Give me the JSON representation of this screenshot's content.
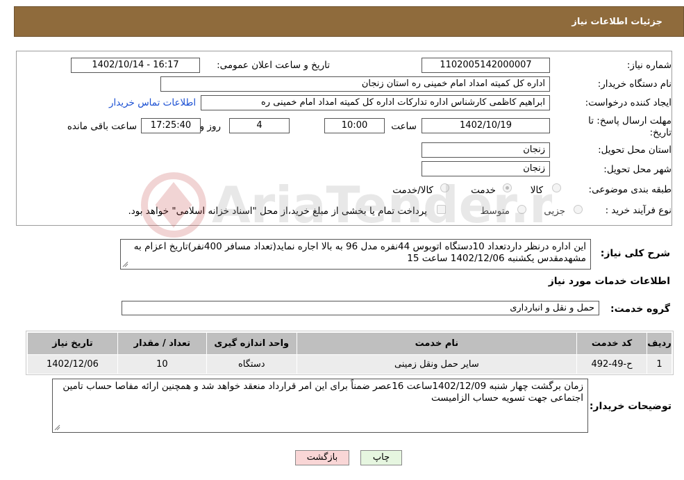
{
  "header": {
    "title": "جزئیات اطلاعات نیاز"
  },
  "form": {
    "need_number": {
      "label": "شماره نیاز:",
      "value": "1102005142000007"
    },
    "announce_datetime": {
      "label": "تاریخ و ساعت اعلان عمومی:",
      "value": "1402/10/14 - 16:17"
    },
    "buyer_org": {
      "label": "نام دستگاه خریدار:",
      "value": "اداره کل کمیته امداد امام خمینی  ره  استان زنجان"
    },
    "requester": {
      "label": "ایجاد کننده درخواست:",
      "value": "ابراهیم  کاظمی  کارشناس اداره تدارکات  اداره کل کمیته امداد امام خمینی  ره"
    },
    "contact_link": "اطلاعات تماس خریدار",
    "deadline": {
      "label_line1": "مهلت ارسال پاسخ: تا",
      "label_line2": "تاریخ:",
      "date": "1402/10/19",
      "time_label": "ساعت",
      "time": "10:00",
      "days": "4",
      "days_label": "روز و",
      "remaining": "17:25:40",
      "remaining_label": "ساعت باقی مانده"
    },
    "delivery_province": {
      "label": "استان محل تحویل:",
      "value": "زنجان"
    },
    "delivery_city": {
      "label": "شهر محل تحویل:",
      "value": "زنجان"
    },
    "category": {
      "label": "طبقه بندی موضوعی:",
      "options": [
        {
          "label": "کالا",
          "checked": false
        },
        {
          "label": "خدمت",
          "checked": true
        },
        {
          "label": "کالا/خدمت",
          "checked": false
        }
      ]
    },
    "purchase_process": {
      "label": "نوع فرآیند خرید :",
      "options": [
        {
          "label": "جزیی",
          "checked": false
        },
        {
          "label": "متوسط",
          "checked": false
        }
      ],
      "note_checkbox_label": "پرداخت تمام یا بخشی از مبلغ خرید،از محل \"اسناد خزانه اسلامی\" خواهد بود."
    }
  },
  "description": {
    "label": "شرح کلی نیاز:",
    "text": "این اداره درنظر داردتعداد 10دستگاه اتوبوس 44نفره  مدل 96 به بالا  اجاره نماید(تعداد مسافر 400نفر)تاریخ اعزام به مشهدمقدس یکشنبه 1402/12/06 ساعت 15"
  },
  "services_section": {
    "title": "اطلاعات خدمات مورد نیاز",
    "group_label": "گروه خدمت:",
    "group_value": "حمل و نقل و انبارداری"
  },
  "table": {
    "headers": [
      "ردیف",
      "کد خدمت",
      "نام خدمت",
      "واحد اندازه گیری",
      "تعداد / مقدار",
      "تاریخ نیاز"
    ],
    "rows": [
      [
        "1",
        "ح-49-492",
        "سایر حمل ونقل زمینی",
        "دستگاه",
        "10",
        "1402/12/06"
      ]
    ]
  },
  "buyer_notes": {
    "label": "توضیحات خریدار:",
    "text": "زمان برگشت چهار شنبه  1402/12/09ساعت 16عصر ضمناً برای این امر قرارداد منعقد خواهد شد و همچنین ارائه مفاصا حساب تامین اجتماعی جهت تسویه حساب الزامیست"
  },
  "buttons": {
    "print": "چاپ",
    "back": "بازگشت"
  },
  "watermark": "AriaTender.neT",
  "colors": {
    "header_bg": "#8f6b3c",
    "link": "#1a4fd3",
    "back_button_bg": "#f9d6d6",
    "print_button_bg": "#e6f6e0"
  }
}
